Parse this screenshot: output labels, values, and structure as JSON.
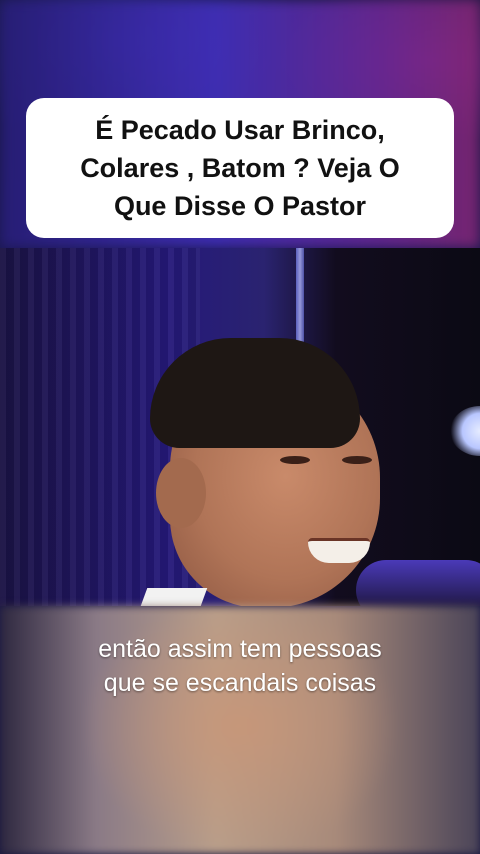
{
  "title_card": {
    "lines": [
      "É Pecado Usar Brinco,",
      "Colares , Batom ? Veja O",
      "Que Disse O Pastor"
    ]
  },
  "caption": {
    "lines": [
      "então assim tem pessoas",
      "que se escandais coisas"
    ]
  },
  "colors": {
    "title_card_bg": "#ffffff",
    "title_text": "#111111",
    "caption_text": "#ffffff"
  }
}
